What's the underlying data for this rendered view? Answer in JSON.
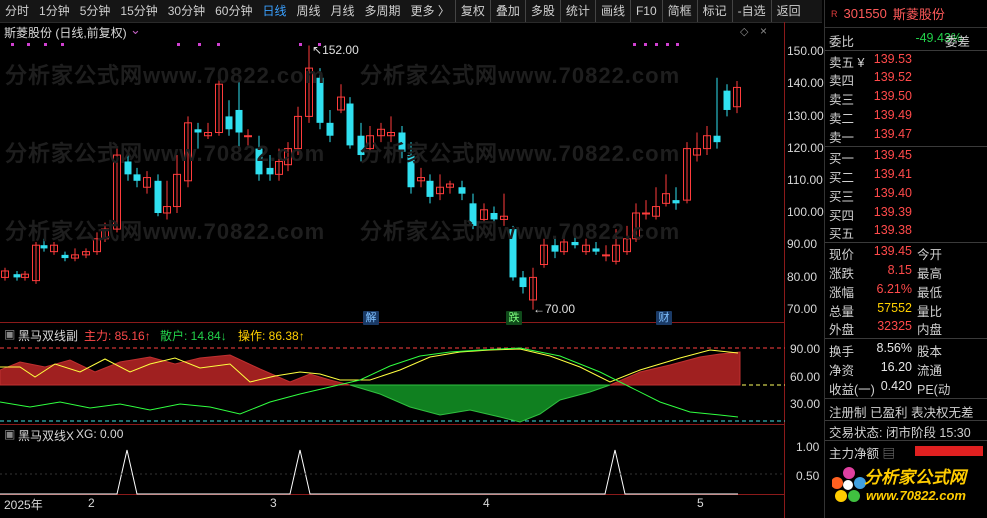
{
  "toolbar": {
    "items": [
      "分时",
      "1分钟",
      "5分钟",
      "15分钟",
      "30分钟",
      "60分钟",
      "日线",
      "周线",
      "月线",
      "多周期",
      "更多 〉",
      "复权",
      "叠加",
      "多股",
      "统计",
      "画线",
      "F10",
      "简框",
      "标记",
      "-自选",
      "返回"
    ],
    "active": "日线"
  },
  "chart": {
    "title": "斯菱股份 (日线,前复权)",
    "high_label": "152.00",
    "low_label": "70.00",
    "y_ticks": [
      "150.00",
      "140.00",
      "130.00",
      "120.00",
      "110.00",
      "100.00",
      "90.00",
      "80.00",
      "70.00"
    ],
    "tags": [
      {
        "text": "解",
        "color": "#1a3a66",
        "fg": "#7fc0ff"
      },
      {
        "text": "跌",
        "color": "#0f4a1a",
        "fg": "#7fff7f"
      },
      {
        "text": "财",
        "color": "#1a3a66",
        "fg": "#7fc0ff"
      }
    ],
    "watermark": "分析家公式网www.70822.com"
  },
  "indicator1": {
    "name": "黑马双线副",
    "main_label": "主力: 85.16↑",
    "retail_label": "散户: 14.84↓",
    "op_label": "操作: 86.38↑",
    "y_ticks": [
      "90.00",
      "60.00",
      "30.00"
    ]
  },
  "indicator2": {
    "name": "黑马双线X",
    "xg_label": "XG: 0.00",
    "y_ticks": [
      "1.00",
      "0.50"
    ]
  },
  "x_axis": [
    "2025年",
    "2",
    "3",
    "4",
    "5"
  ],
  "quote": {
    "badge": "R",
    "code": "301550",
    "name": "斯菱股份",
    "webi_label": "委比",
    "webi_value": "-49.43%",
    "weicha_label": "委差",
    "sell": [
      {
        "label": "卖五 ¥",
        "price": "139.53"
      },
      {
        "label": "卖四",
        "price": "139.52"
      },
      {
        "label": "卖三",
        "price": "139.50"
      },
      {
        "label": "卖二",
        "price": "139.49"
      },
      {
        "label": "卖一",
        "price": "139.47"
      }
    ],
    "buy": [
      {
        "label": "买一",
        "price": "139.45"
      },
      {
        "label": "买二",
        "price": "139.41"
      },
      {
        "label": "买三",
        "price": "139.40"
      },
      {
        "label": "买四",
        "price": "139.39"
      },
      {
        "label": "买五",
        "price": "139.38"
      }
    ],
    "stats": [
      {
        "label": "现价",
        "value": "139.45",
        "label2": "今开"
      },
      {
        "label": "涨跌",
        "value": "8.15",
        "label2": "最高"
      },
      {
        "label": "涨幅",
        "value": "6.21%",
        "label2": "最低"
      },
      {
        "label": "总量",
        "value": "57552",
        "label2": "量比"
      },
      {
        "label": "外盘",
        "value": "32325",
        "label2": "内盘"
      }
    ],
    "stats2": [
      {
        "label": "换手",
        "value": "8.56%",
        "label2": "股本"
      },
      {
        "label": "净资",
        "value": "16.20",
        "label2": "流通"
      },
      {
        "label": "收益(一)",
        "value": "0.420",
        "label2": "PE(动"
      }
    ],
    "flags": "注册制 已盈利 表决权无差",
    "trade_status": "交易状态: 闭市阶段 15:30",
    "net_label": "主力净额",
    "logo_text1": "分析家公式网",
    "logo_text2": "www.70822.com"
  }
}
